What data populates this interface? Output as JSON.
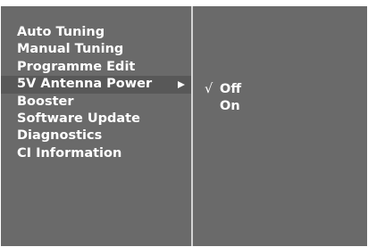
{
  "menu": {
    "items": [
      {
        "label": "Auto Tuning"
      },
      {
        "label": "Manual Tuning"
      },
      {
        "label": "Programme Edit"
      },
      {
        "label": "5V Antenna Power",
        "selected": true,
        "submenu_icon": "right-arrow-icon"
      },
      {
        "label": "Booster"
      },
      {
        "label": "Software Update"
      },
      {
        "label": "Diagnostics"
      },
      {
        "label": "CI Information"
      }
    ]
  },
  "submenu": {
    "check_mark": "√",
    "options": [
      {
        "label": "Off",
        "checked": true
      },
      {
        "label": "On",
        "checked": false
      }
    ]
  },
  "colors": {
    "panel_background": "#6a6a6a",
    "highlight_background": "#585858",
    "divider": "#d4d4d4",
    "text": "#ffffff"
  }
}
